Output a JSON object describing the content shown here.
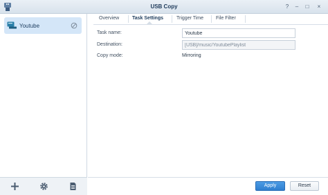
{
  "window": {
    "title": "USB Copy",
    "controls": [
      "?",
      "–",
      "□",
      "×"
    ]
  },
  "sidebar": {
    "tasks": [
      {
        "label": "Youtube",
        "icon": "usb-task-icon",
        "status_icon": "disabled-status-icon"
      }
    ],
    "footer_buttons": [
      {
        "icon": "plus-icon"
      },
      {
        "icon": "gear-icon"
      },
      {
        "icon": "log-icon"
      }
    ]
  },
  "tabs": [
    {
      "label": "Overview"
    },
    {
      "label": "Task Settings",
      "active": true
    },
    {
      "label": "Trigger Time"
    },
    {
      "label": "File Filter"
    }
  ],
  "form": {
    "task_name_label": "Task name:",
    "task_name_value": "Youtube",
    "destination_label": "Destination:",
    "destination_value": "[USB]/music/YoutubePlaylist",
    "copy_mode_label": "Copy mode:",
    "copy_mode_value": "Mirroring"
  },
  "actions": {
    "apply": "Apply",
    "reset": "Reset"
  },
  "colors": {
    "accent": "#2f7fd0",
    "selection": "#d4e6f8",
    "titlebar": "#dfe7f0"
  }
}
